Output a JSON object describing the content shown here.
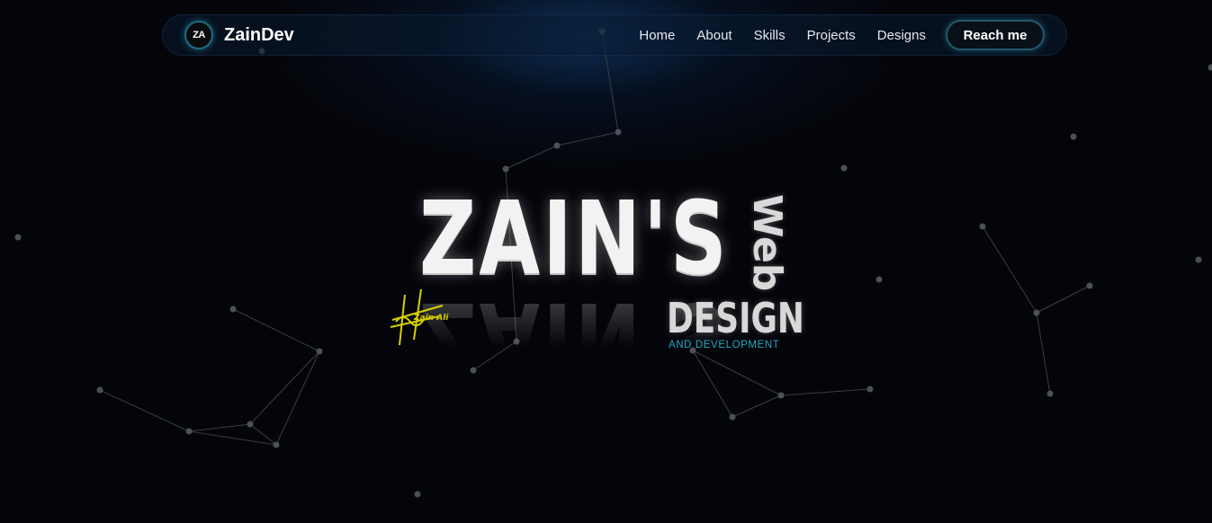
{
  "navbar": {
    "logo_text": "ZA",
    "brand_name": "ZainDev",
    "links": [
      {
        "label": "Home"
      },
      {
        "label": "About"
      },
      {
        "label": "Skills"
      },
      {
        "label": "Projects"
      },
      {
        "label": "Designs"
      }
    ],
    "cta_label": "Reach me"
  },
  "hero": {
    "main_word": "ZAIN'S",
    "side_word": "Web",
    "design_word": "DESIGN",
    "tagline": "AND DEVELOPMENT",
    "signature_text": "Zain Ali"
  },
  "colors": {
    "background": "#04050a",
    "accent_cyan": "#21a9c6",
    "signature_yellow": "#d7d000",
    "constellation": "#4d5057"
  },
  "icons": [
    "constellation-background",
    "signature-mark"
  ]
}
